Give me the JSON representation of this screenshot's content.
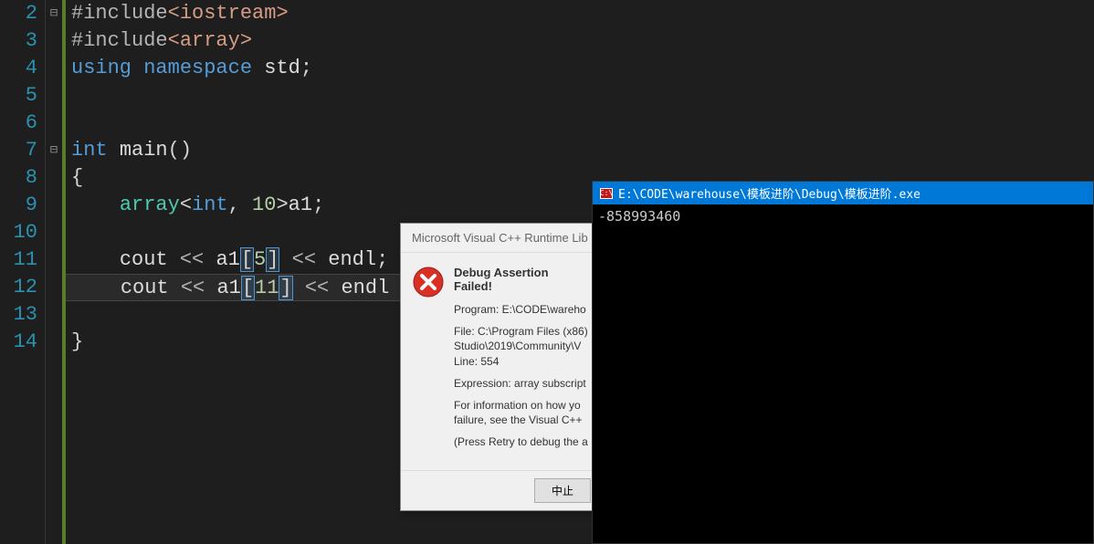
{
  "editor": {
    "lines": [
      {
        "num": "2",
        "fold": "⊟"
      },
      {
        "num": "3",
        "fold": ""
      },
      {
        "num": "4",
        "fold": ""
      },
      {
        "num": "5",
        "fold": ""
      },
      {
        "num": "6",
        "fold": ""
      },
      {
        "num": "7",
        "fold": "⊟"
      },
      {
        "num": "8",
        "fold": ""
      },
      {
        "num": "9",
        "fold": ""
      },
      {
        "num": "10",
        "fold": ""
      },
      {
        "num": "11",
        "fold": ""
      },
      {
        "num": "12",
        "fold": ""
      },
      {
        "num": "13",
        "fold": ""
      },
      {
        "num": "14",
        "fold": ""
      }
    ],
    "code": {
      "include1_pre": "#include",
      "include1_hdr": "<iostream>",
      "include2_pre": "#include",
      "include2_hdr": "<array>",
      "using": "using",
      "namespace": "namespace",
      "std": "std",
      "semi": ";",
      "int": "int",
      "main": "main",
      "parens": "()",
      "lbrace": "{",
      "array": "array",
      "lt": "<",
      "arr_int": "int",
      "comma": ",",
      "ten": "10",
      "gt": ">",
      "a1": "a1",
      "cout": "cout",
      "lshift": "<<",
      "lbr": "[",
      "five": "5",
      "eleven": "11",
      "rbr": "]",
      "endl": "endl",
      "rbrace": "}"
    }
  },
  "dialog": {
    "title": "Microsoft Visual C++ Runtime Lib",
    "heading": "Debug Assertion Failed!",
    "program": "Program: E:\\CODE\\wareho",
    "file": "File: C:\\Program Files (x86)",
    "studio": "Studio\\2019\\Community\\V",
    "line": "Line: 554",
    "expr": "Expression: array subscript",
    "info1": "For information on how yo",
    "info2": "failure, see the Visual C++",
    "retry": "(Press Retry to debug the a",
    "button": "中止"
  },
  "console": {
    "title": "E:\\CODE\\warehouse\\模板进阶\\Debug\\模板进阶.exe",
    "icon_text": "C:\\",
    "output": "-858993460"
  }
}
